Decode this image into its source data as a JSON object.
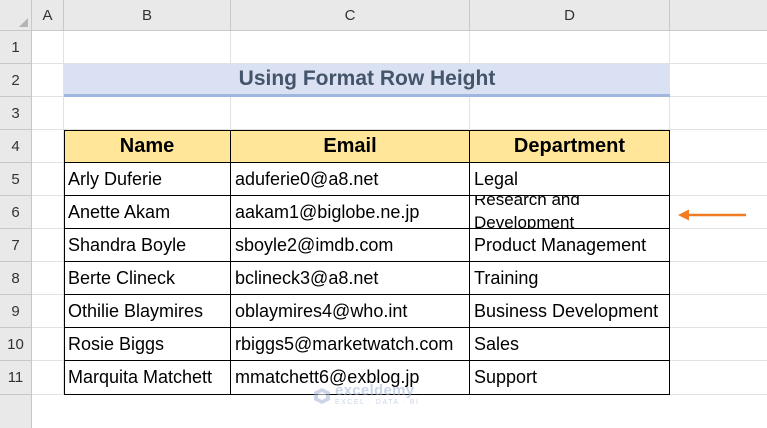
{
  "columns": [
    "A",
    "B",
    "C",
    "D"
  ],
  "rows": [
    "1",
    "2",
    "3",
    "4",
    "5",
    "6",
    "7",
    "8",
    "9",
    "10",
    "11"
  ],
  "title": "Using Format Row Height",
  "table": {
    "headers": [
      "Name",
      "Email",
      "Department"
    ],
    "rows": [
      {
        "name": "Arly Duferie",
        "email": "aduferie0@a8.net",
        "department": "Legal"
      },
      {
        "name": "Anette Akam",
        "email": "aakam1@biglobe.ne.jp",
        "department": "Research and Development"
      },
      {
        "name": "Shandra Boyle",
        "email": "sboyle2@imdb.com",
        "department": "Product Management"
      },
      {
        "name": "Berte Clineck",
        "email": "bclineck3@a8.net",
        "department": "Training"
      },
      {
        "name": "Othilie Blaymires",
        "email": "oblaymires4@who.int",
        "department": "Business Development"
      },
      {
        "name": "Rosie Biggs",
        "email": "rbiggs5@marketwatch.com",
        "department": "Sales"
      },
      {
        "name": "Marquita Matchett",
        "email": "mmatchett6@exblog.jp",
        "department": "Support"
      }
    ]
  },
  "watermark": {
    "name": "exceldemy",
    "tagline": "EXCEL · DATA · BI"
  },
  "colors": {
    "header_fill": "#ffe699",
    "title_fill": "#dae1f2",
    "arrow": "#f07b22"
  }
}
